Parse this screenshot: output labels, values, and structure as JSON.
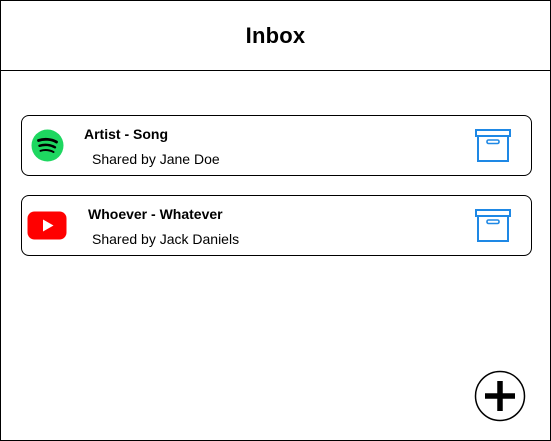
{
  "header": {
    "title": "Inbox"
  },
  "shares": [
    {
      "title": "Artist - Song",
      "subtitle": "Shared by Jane Doe",
      "service_icon": "spotify-icon"
    },
    {
      "title": "Whoever - Whatever",
      "subtitle": "Shared by Jack Daniels",
      "service_icon": "youtube-icon"
    }
  ],
  "icons": {
    "archive": "archive-box-icon",
    "add": "plus-circle-icon"
  },
  "colors": {
    "spotify": "#1ED760",
    "youtube": "#FF0000",
    "archive": "#1E88E5"
  }
}
